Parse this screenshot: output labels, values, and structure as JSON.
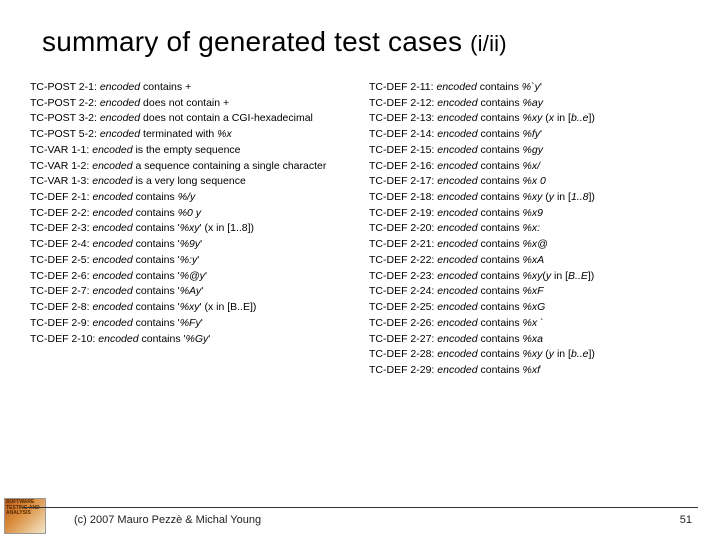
{
  "title_main": "summary of generated test cases",
  "title_sub": "(i/ii)",
  "left": [
    {
      "id": "TC-POST 2-1:",
      "pre": " ",
      "em": "encoded",
      "post": " contains +"
    },
    {
      "id": "TC-POST 2-2:",
      "pre": " ",
      "em": "encoded",
      "post": " does not contain +"
    },
    {
      "id": "TC-POST 3-2:",
      "pre": " ",
      "em": "encoded",
      "post": " does not contain a CGI-hexadecimal"
    },
    {
      "id": "TC-POST 5-2:",
      "pre": " ",
      "em": "encoded",
      "post": " terminated with ",
      "em2": "%x"
    },
    {
      "id": "TC-VAR 1-1:",
      "pre": " ",
      "em": "encoded",
      "post": " is the empty sequence"
    },
    {
      "id": "TC-VAR 1-2:",
      "pre": " ",
      "em": "encoded",
      "post": " a sequence containing a single character"
    },
    {
      "id": "TC-VAR 1-3:",
      "pre": " ",
      "em": "encoded",
      "post": " is a very long sequence"
    },
    {
      "id": "TC-DEF 2-1:",
      "pre": " ",
      "em": "encoded",
      "post": " contains ",
      "em2": "%/y"
    },
    {
      "id": "TC-DEF 2-2:",
      "pre": " ",
      "em": "encoded",
      "post": " contains ",
      "em2": "%0 y"
    },
    {
      "id": "TC-DEF 2-3:",
      "pre": " ",
      "em": "encoded",
      "post": " contains '",
      "em2": "%xy",
      "post2": "' (x in [1..8])"
    },
    {
      "id": "TC-DEF 2-4:",
      "pre": " ",
      "em": "encoded",
      "post": " contains '",
      "em2": "%9y",
      "post2": "'"
    },
    {
      "id": "TC-DEF 2-5:",
      "pre": " ",
      "em": "encoded",
      "post": " contains '",
      "em2": "%:y",
      "post2": "'"
    },
    {
      "id": "TC-DEF 2-6:",
      "pre": " ",
      "em": "encoded",
      "post": " contains '",
      "em2": "%@y",
      "post2": "'"
    },
    {
      "id": "TC-DEF 2-7:",
      "pre": " ",
      "em": "encoded",
      "post": " contains '",
      "em2": "%Ay",
      "post2": "'"
    },
    {
      "id": "TC-DEF 2-8:",
      "pre": " ",
      "em": "encoded",
      "post": " contains '",
      "em2": "%xy",
      "post2": "' (x in [B..E])"
    },
    {
      "id": "TC-DEF 2-9:",
      "pre": " ",
      "em": "encoded",
      "post": " contains '",
      "em2": "%Fy",
      "post2": "'"
    },
    {
      "id": "TC-DEF 2-10:",
      "pre": " ",
      "em": "encoded",
      "post": " contains '",
      "em2": "%Gy",
      "post2": "'"
    }
  ],
  "right": [
    {
      "id": "TC-DEF 2-11:",
      "pre": " ",
      "em": "encoded",
      "post": " contains ",
      "em2": "%`y",
      "post2": "'"
    },
    {
      "id": "TC-DEF 2-12:",
      "pre": " ",
      "em": "encoded",
      "post": " contains ",
      "em2": "%ay"
    },
    {
      "id": "TC-DEF 2-13:",
      "pre": " ",
      "em": "encoded",
      "post": " contains ",
      "em2": "%xy",
      "post2": " (",
      "em3": "x",
      "post3": " in [",
      "em4": "b..e",
      "post4": "])"
    },
    {
      "id": "TC-DEF 2-14:",
      "pre": " ",
      "em": "encoded",
      "post": " contains ",
      "em2": "%fy",
      "post2": "'"
    },
    {
      "id": "TC-DEF 2-15:",
      "pre": " ",
      "em": "encoded",
      "post": " contains ",
      "em2": "%gy"
    },
    {
      "id": "TC-DEF 2-16:",
      "pre": " ",
      "em": "encoded",
      "post": " contains ",
      "em2": "%x/"
    },
    {
      "id": "TC-DEF 2-17:",
      "pre": " ",
      "em": "encoded",
      "post": " contains ",
      "em2": "%x 0"
    },
    {
      "id": "TC-DEF 2-18:",
      "pre": " ",
      "em": "encoded",
      "post": " contains ",
      "em2": "%xy",
      "post2": " (",
      "em3": "y",
      "post3": " in [",
      "em4": "1..8",
      "post4": "])"
    },
    {
      "id": "TC-DEF 2-19:",
      "pre": " ",
      "em": "encoded",
      "post": " contains ",
      "em2": "%x9"
    },
    {
      "id": "TC-DEF 2-20:",
      "pre": " ",
      "em": "encoded",
      "post": " contains ",
      "em2": "%x:"
    },
    {
      "id": "TC-DEF 2-21:",
      "pre": " ",
      "em": "encoded",
      "post": " contains ",
      "em2": "%x@"
    },
    {
      "id": "TC-DEF 2-22:",
      "pre": " ",
      "em": "encoded",
      "post": " contains ",
      "em2": "%xA"
    },
    {
      "id": "TC-DEF 2-23:",
      "pre": " ",
      "em": "encoded",
      "post": " contains ",
      "em2": "%xy",
      "post2": "(",
      "em3": "y",
      "post3": " in [",
      "em4": "B..E",
      "post4": "])"
    },
    {
      "id": "TC-DEF 2-24:",
      "pre": " ",
      "em": "encoded",
      "post": " contains ",
      "em2": "%xF"
    },
    {
      "id": "TC-DEF 2-25:",
      "pre": " ",
      "em": "encoded",
      "post": " contains ",
      "em2": "%xG"
    },
    {
      "id": "TC-DEF 2-26:",
      "pre": " ",
      "em": "encoded",
      "post": " contains ",
      "em2": "%x `"
    },
    {
      "id": "TC-DEF 2-27:",
      "pre": " ",
      "em": "encoded",
      "post": " contains ",
      "em2": "%xa"
    },
    {
      "id": "TC-DEF 2-28:",
      "pre": " ",
      "em": "encoded",
      "post": " contains ",
      "em2": "%xy",
      "post2": " (",
      "em3": "y",
      "post3": " in [",
      "em4": "b..e",
      "post4": "])"
    },
    {
      "id": "TC-DEF 2-29:",
      "pre": " ",
      "em": "encoded",
      "post": " contains ",
      "em2": "%xf"
    }
  ],
  "footer": {
    "logo_text": "SOFTWARE TESTING AND ANALYSIS",
    "copyright": "(c) 2007 Mauro Pezzè & Michal Young",
    "page": "51"
  }
}
